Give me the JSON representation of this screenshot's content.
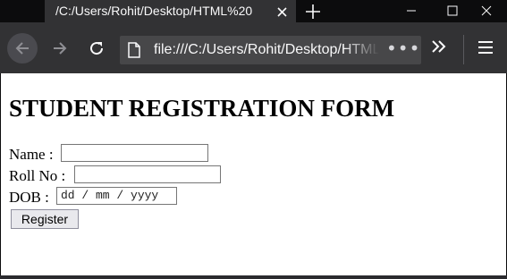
{
  "window": {
    "tab_title": "/C:/Users/Rohit/Desktop/HTML%20",
    "icons": {
      "tab_close": "close-icon",
      "new_tab": "plus-icon",
      "minimize": "minimize-icon",
      "maximize": "maximize-icon",
      "close": "close-icon"
    }
  },
  "toolbar": {
    "url": "file:///C:/Users/Rohit/Desktop/HTML%20",
    "page_actions": "•••",
    "icons": {
      "back": "arrow-left-icon",
      "forward": "arrow-right-icon",
      "reload": "reload-icon",
      "page": "page-icon",
      "overflow": "chevron-double-right-icon",
      "menu": "hamburger-menu-icon"
    }
  },
  "form": {
    "title": "STUDENT REGISTRATION FORM",
    "name_label": "Name :",
    "name_value": "",
    "roll_label": "Roll No :",
    "roll_value": "",
    "dob_label": "DOB :",
    "dob_placeholder": "dd / mm / yyyy",
    "submit_label": "Register"
  },
  "colors": {
    "titlebar": "#0c0c0d",
    "toolbar": "#323234",
    "urlbar": "#474749",
    "page_background": "#ffffff"
  }
}
